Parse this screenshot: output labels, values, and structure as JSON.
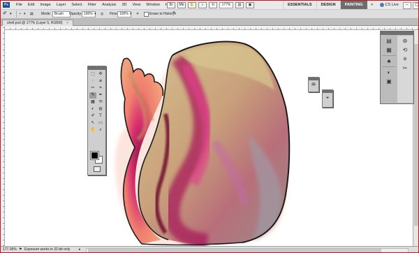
{
  "menubar": {
    "logo": "Ps",
    "items": [
      "File",
      "Edit",
      "Image",
      "Layer",
      "Select",
      "Filter",
      "Analysis",
      "3D",
      "View",
      "Window",
      "Help"
    ],
    "zoom_menu": "177%"
  },
  "workspaces": {
    "items": [
      "ESSENTIALS",
      "DESIGN",
      "PAINTING"
    ],
    "active": "PAINTING",
    "more": "»",
    "cs_live": "CS Live"
  },
  "options": {
    "mode_label": "Mode:",
    "mode_value": "Brush",
    "opacity_label": "Opacity:",
    "opacity_value": "100%",
    "flow_label": "Flow:",
    "flow_value": "100%",
    "erase_history": "Erase to History"
  },
  "document": {
    "tab_title": "shell.psd @ 177% (Layer 5, RGB/8)",
    "tab_close": "×"
  },
  "status": {
    "zoom": "177.36%",
    "message": "Exposure works in 32-bit only"
  },
  "tools": {
    "items": [
      "⬚",
      "✣",
      "◌",
      "⌀",
      "✂",
      "⌖",
      "✎",
      "✒",
      "▦",
      "⟲",
      "◐",
      "◍",
      "✐",
      "T",
      "↖",
      "▭",
      "✋",
      "⌕"
    ]
  },
  "colors": {
    "accent_red": "#c8161d",
    "chrome": "#e9e9e9",
    "workspace_active": "#6d6d6d"
  }
}
